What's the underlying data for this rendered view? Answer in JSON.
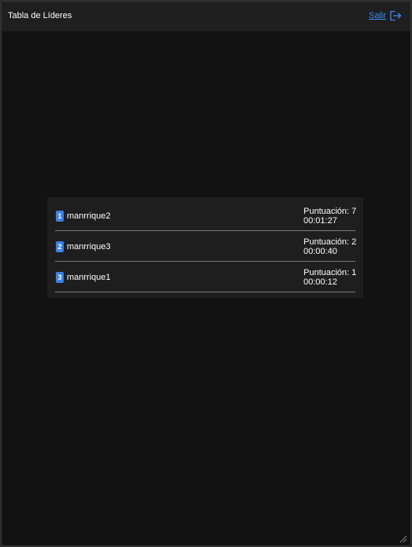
{
  "header": {
    "title": "Tabla de Líderes",
    "exit_label": "Salir"
  },
  "leaderboard": [
    {
      "rank": "1",
      "name": "manrrique2",
      "score_label": "Puntuación: 7",
      "time": "00:01:27"
    },
    {
      "rank": "2",
      "name": "manrrique3",
      "score_label": "Puntuación: 2",
      "time": "00:00:40"
    },
    {
      "rank": "3",
      "name": "manrrique1",
      "score_label": "Puntuación: 1",
      "time": "00:00:12"
    }
  ],
  "colors": {
    "accent": "#3b82e6",
    "background": "#121212",
    "panel": "#1e1e1e"
  },
  "icons": {
    "exit": "exit-door-arrow-icon",
    "resize": "resize-grip-icon"
  }
}
